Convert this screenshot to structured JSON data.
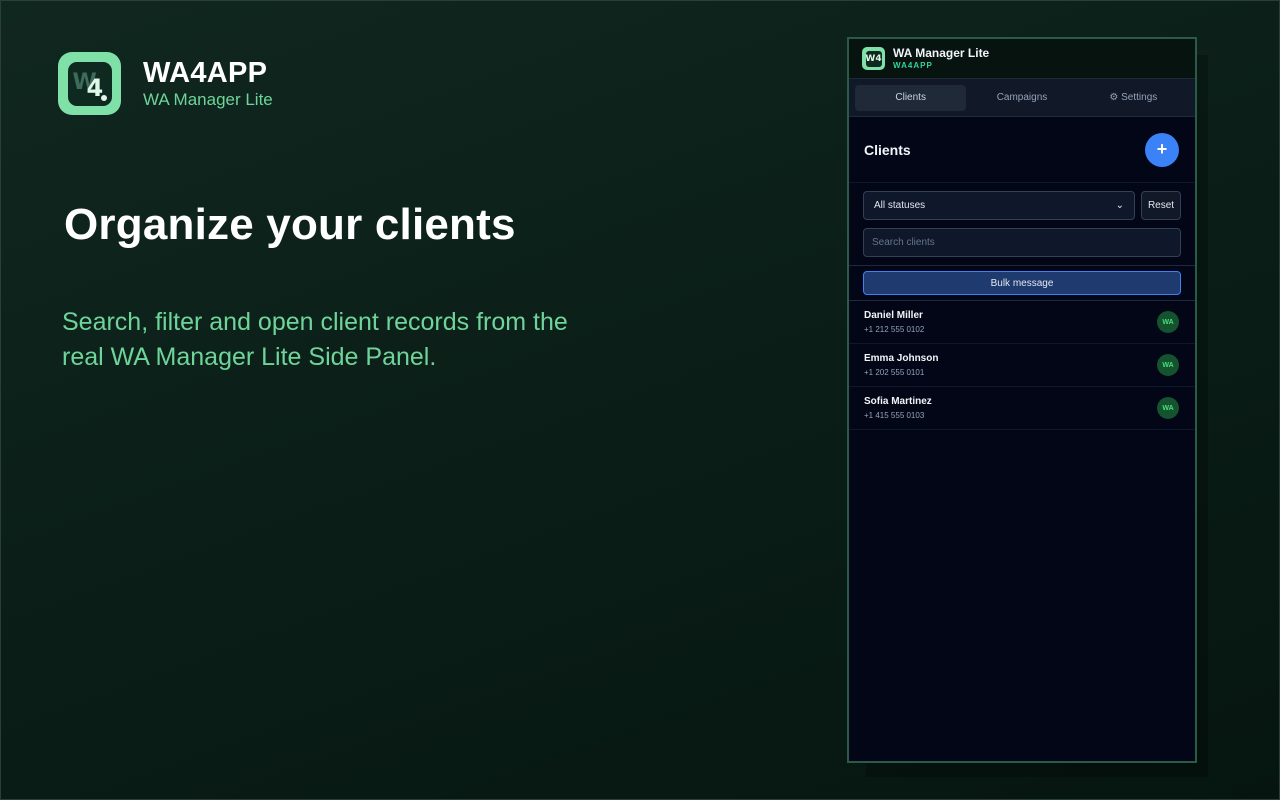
{
  "brand": {
    "logo_glyph_w": "W",
    "logo_glyph_4": "4",
    "name": "WA4APP",
    "subtitle": "WA Manager Lite"
  },
  "hero": {
    "headline": "Organize your clients",
    "subline": "Search, filter and open client records from the real WA Manager Lite Side Panel."
  },
  "panel": {
    "logo_glyph": "W4",
    "title": "WA Manager Lite",
    "brand": "WA4APP",
    "tabs": [
      {
        "label": "Clients",
        "active": true
      },
      {
        "label": "Campaigns",
        "active": false
      },
      {
        "label": "⚙ Settings",
        "active": false
      }
    ],
    "section_title": "Clients",
    "add_label": "+",
    "status_filter": {
      "selected": "All statuses"
    },
    "reset_label": "Reset",
    "search": {
      "value": "",
      "placeholder": "Search clients"
    },
    "bulk_label": "Bulk message",
    "clients": [
      {
        "name": "Daniel Miller",
        "phone": "+1 212 555 0102",
        "badge": "WA"
      },
      {
        "name": "Emma Johnson",
        "phone": "+1 202 555 0101",
        "badge": "WA"
      },
      {
        "name": "Sofia Martinez",
        "phone": "+1 415 555 0103",
        "badge": "WA"
      }
    ]
  },
  "colors": {
    "accent_green": "#6fd49a",
    "primary_blue": "#3b82f6",
    "panel_bg": "#020617",
    "badge_bg": "#14532d"
  },
  "icons": {
    "brand_logo": "wa4-logo-icon",
    "add": "plus-icon",
    "select": "chevron-down-icon",
    "settings": "gear-icon"
  }
}
